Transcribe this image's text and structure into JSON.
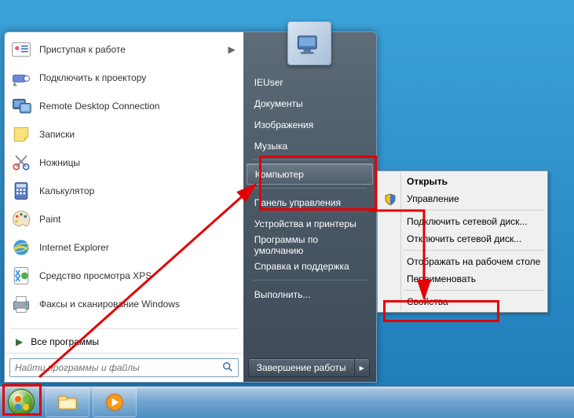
{
  "programs": [
    {
      "label": "Приступая к работе",
      "arrow": true,
      "icon": "getting-started"
    },
    {
      "label": "Подключить к проектору",
      "arrow": false,
      "icon": "projector"
    },
    {
      "label": "Remote Desktop Connection",
      "arrow": false,
      "icon": "rdc"
    },
    {
      "label": "Записки",
      "arrow": false,
      "icon": "sticky"
    },
    {
      "label": "Ножницы",
      "arrow": false,
      "icon": "snip"
    },
    {
      "label": "Калькулятор",
      "arrow": false,
      "icon": "calc"
    },
    {
      "label": "Paint",
      "arrow": false,
      "icon": "paint"
    },
    {
      "label": "Internet Explorer",
      "arrow": false,
      "icon": "ie"
    },
    {
      "label": "Средство просмотра XPS",
      "arrow": false,
      "icon": "xps"
    },
    {
      "label": "Факсы и сканирование Windows",
      "arrow": false,
      "icon": "fax"
    }
  ],
  "all_programs": "Все программы",
  "search_placeholder": "Найти программы и файлы",
  "right_items": [
    {
      "label": "IEUser",
      "sep": false
    },
    {
      "label": "Документы",
      "sep": false
    },
    {
      "label": "Изображения",
      "sep": false
    },
    {
      "label": "Музыка",
      "sep": true
    },
    {
      "label": "Компьютер",
      "sep": true,
      "hl": true
    },
    {
      "label": "Панель управления",
      "sep": false
    },
    {
      "label": "Устройства и принтеры",
      "sep": false
    },
    {
      "label": "Программы по умолчанию",
      "sep": false
    },
    {
      "label": "Справка и поддержка",
      "sep": true
    },
    {
      "label": "Выполнить...",
      "sep": false
    }
  ],
  "shutdown": "Завершение работы",
  "context_menu": [
    {
      "label": "Открыть",
      "bold": true
    },
    {
      "label": "Управление",
      "icon": "shield",
      "sep_after": true
    },
    {
      "label": "Подключить сетевой диск..."
    },
    {
      "label": "Отключить сетевой диск...",
      "sep_after": true
    },
    {
      "label": "Отображать на рабочем столе"
    },
    {
      "label": "Переименовать",
      "sep_after": true
    },
    {
      "label": "Свойства"
    }
  ]
}
